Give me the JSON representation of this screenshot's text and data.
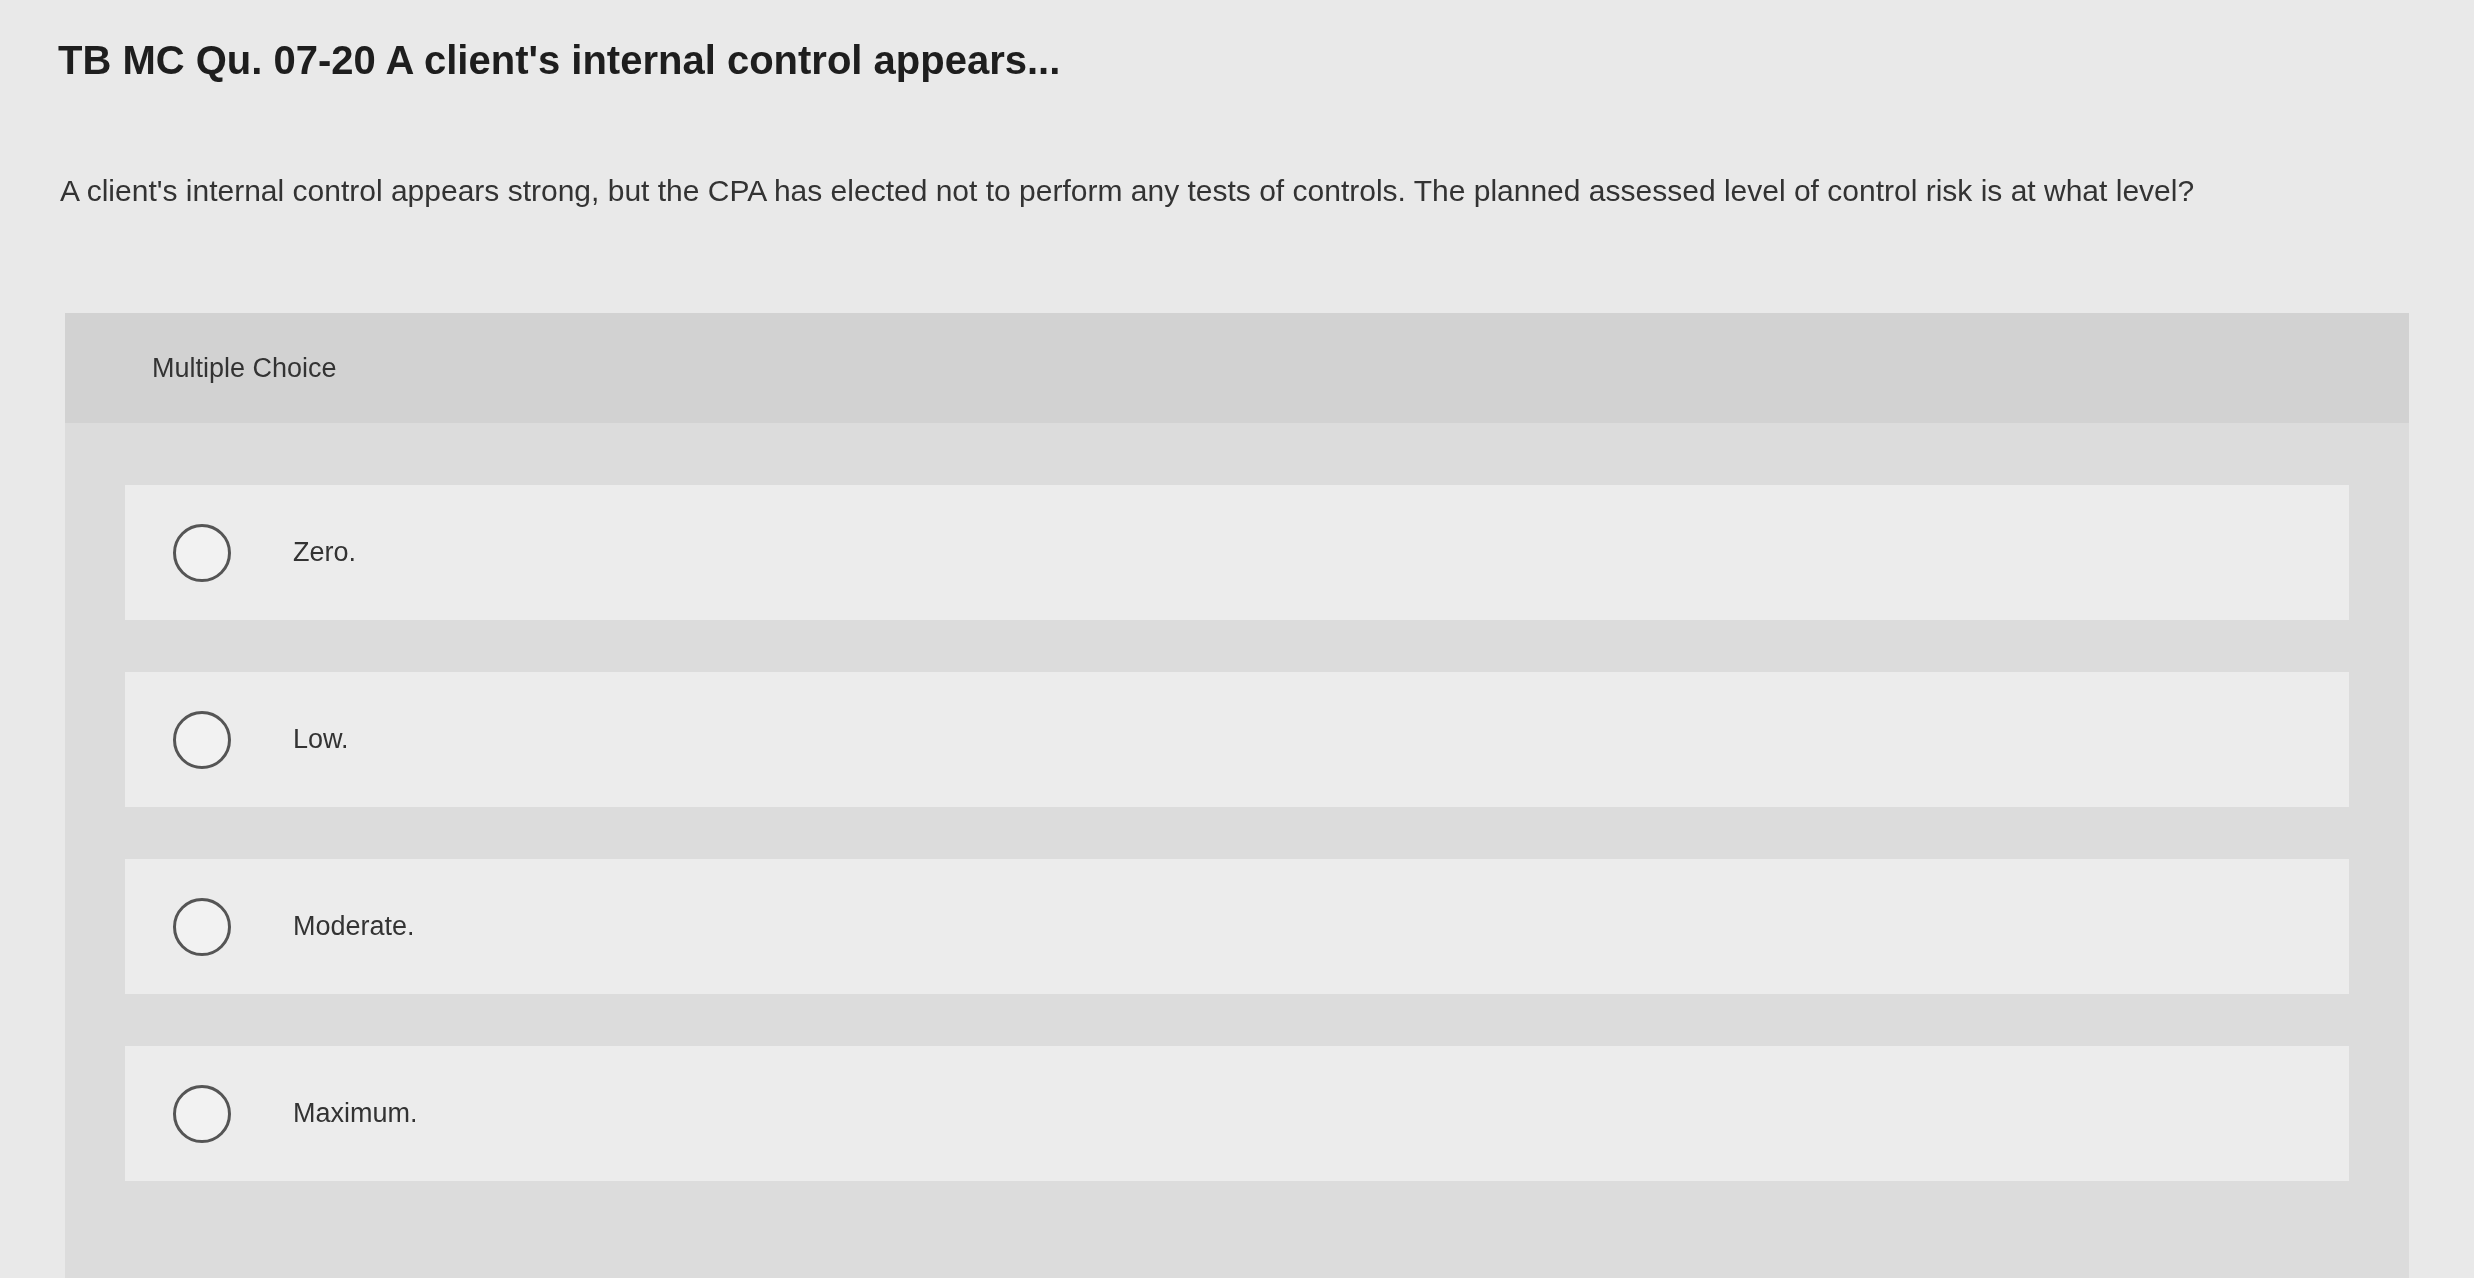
{
  "title": "TB MC Qu. 07-20 A client's internal control appears...",
  "question": "A client's internal control appears strong, but the CPA has elected not to perform any tests of controls. The planned assessed level of control risk is at what level?",
  "panel": {
    "heading": "Multiple Choice",
    "options": [
      {
        "label": "Zero.",
        "selected": false
      },
      {
        "label": "Low.",
        "selected": false
      },
      {
        "label": "Moderate.",
        "selected": false
      },
      {
        "label": "Maximum.",
        "selected": false
      }
    ]
  }
}
